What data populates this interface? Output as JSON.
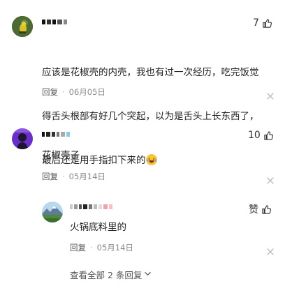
{
  "comments": [
    {
      "username": "",
      "like_count": "7",
      "text_lines": [
        "应该是花椒壳的内壳，我也有过一次经历，吃完饭觉",
        "得舌头根部有好几个突起，以为是舌头上长东西了，",
        "最后还是用手指扣下来的"
      ],
      "reply_label": "回复",
      "date": "06月05日",
      "emoji": "laughing-with-tears-emoji"
    },
    {
      "username": "",
      "like_count": "10",
      "text": "花椒壳子",
      "reply_label": "回复",
      "date": "05月14日"
    }
  ],
  "reply": {
    "username": "",
    "like_label": "赞",
    "text": "火锅底料里的",
    "reply_label": "回复",
    "date": "05月14日"
  },
  "view_all": {
    "label": "查看全部 2 条回复"
  },
  "icons": {
    "like": "thumbs-up-icon",
    "close": "close-icon",
    "expand": "chevron-down-icon"
  },
  "colors": {
    "text_primary": "#222222",
    "text_secondary": "#8a8a8a",
    "icon_gray": "#bbbbbb"
  }
}
